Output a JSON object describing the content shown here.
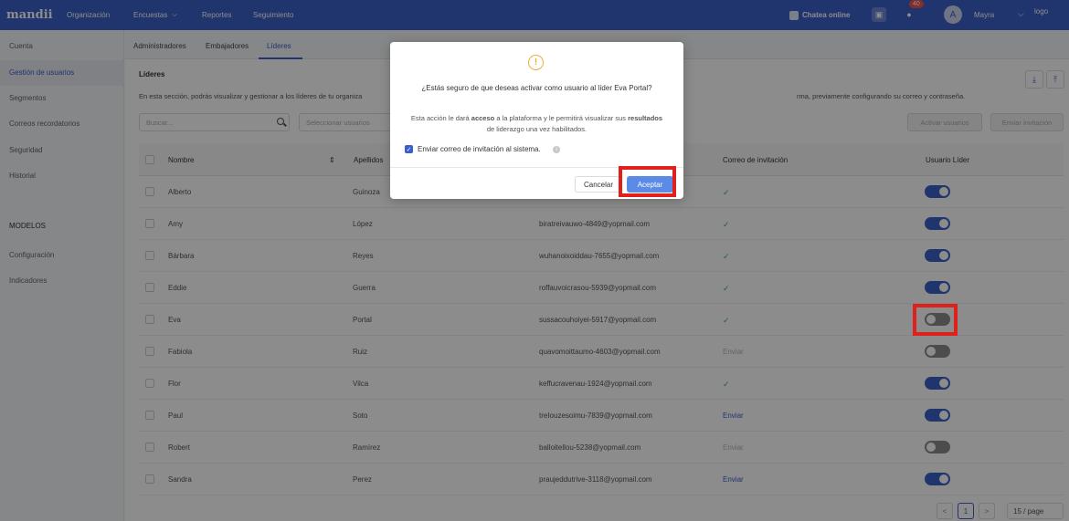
{
  "topbar": {
    "logo": "mandii",
    "nav": [
      "Organización",
      "Encuestas",
      "Reportes",
      "Seguimiento"
    ],
    "nav_chevron": "⌵",
    "chat_label": "Chatea online",
    "notification_count": "40",
    "avatar_letter": "A",
    "user_name": "Mayra",
    "logo_alt": "logo",
    "icons": [
      "chat-icon",
      "briefcase-icon",
      "bell-icon",
      "chevron-down-icon"
    ]
  },
  "sidebar": {
    "items": [
      "Cuenta",
      "Gestión de usuarios",
      "Segmentos",
      "Correos recordatorios",
      "Seguridad",
      "Historial"
    ],
    "section": "MODELOS",
    "section_items": [
      "Configuración",
      "Indicadores"
    ]
  },
  "tabs": [
    "Administradores",
    "Embajadores",
    "Líderes"
  ],
  "page": {
    "title": "Líderes",
    "description_left": "En esta sección, podrás visualizar y gestionar a los líderes de tu organiza",
    "description_right": "rma, previamente configurando su correo y contraseña.",
    "search_placeholder": "Buscar...",
    "select_placeholder": "Seleccionar usuarios",
    "activate_btn": "Activar usuarios",
    "invite_btn": "Enviar invitación"
  },
  "table": {
    "headers": [
      "Nombre",
      "Apellidos",
      "Correo de invitación",
      "Usuario Líder"
    ],
    "rows": [
      {
        "name": "Alberto",
        "last": "Guinoza",
        "email": "",
        "invite": "✓",
        "invite_type": "check",
        "leader": true
      },
      {
        "name": "Amy",
        "last": "López",
        "email": "biratreivauwo-4849@yopmail.com",
        "invite": "✓",
        "invite_type": "check",
        "leader": true
      },
      {
        "name": "Bárbara",
        "last": "Reyes",
        "email": "wuhanoixoiddau-7655@yopmail.com",
        "invite": "✓",
        "invite_type": "check",
        "leader": true
      },
      {
        "name": "Eddie",
        "last": "Guerra",
        "email": "roffauvoicrasou-5939@yopmail.com",
        "invite": "✓",
        "invite_type": "check",
        "leader": true
      },
      {
        "name": "Eva",
        "last": "Portal",
        "email": "sussacouhoiyei-5917@yopmail.com",
        "invite": "✓",
        "invite_type": "check",
        "leader": false
      },
      {
        "name": "Fabiola",
        "last": "Ruiz",
        "email": "quavomoittaumo-4603@yopmail.com",
        "invite": "Enviar",
        "invite_type": "disabled",
        "leader": false
      },
      {
        "name": "Flor",
        "last": "Vilca",
        "email": "keffucravenau-1924@yopmail.com",
        "invite": "✓",
        "invite_type": "check",
        "leader": true
      },
      {
        "name": "Paul",
        "last": "Soto",
        "email": "treIouzesoimu-7839@yopmail.com",
        "invite": "Enviar",
        "invite_type": "link",
        "leader": true
      },
      {
        "name": "Robert",
        "last": "Ramírez",
        "email": "balloitellou-5238@yopmail.com",
        "invite": "Enviar",
        "invite_type": "disabled",
        "leader": false
      },
      {
        "name": "Sandra",
        "last": "Perez",
        "email": "praujeddutrive-3118@yopmail.com",
        "invite": "Enviar",
        "invite_type": "link",
        "leader": true
      }
    ]
  },
  "pagination": {
    "prev": "<",
    "current": "1",
    "next": ">",
    "page_size": "15 / page"
  },
  "modal": {
    "title": "¿Estás seguro de que deseas activar como usuario al líder Eva Portal?",
    "body_1": "Esta acción le dará ",
    "body_bold_1": "acceso",
    "body_2": " a la plataforma y le permitirá visualizar sus ",
    "body_bold_2": "resultados",
    "body_3": " de liderazgo una vez habilitados.",
    "checkbox_label": "Enviar correo de invitación al sistema.",
    "cancel": "Cancelar",
    "accept": "Aceptar"
  },
  "colors": {
    "primary": "#3b5fc8",
    "highlight": "#e0201a",
    "success": "#34b27b",
    "warning": "#f2a93b"
  }
}
